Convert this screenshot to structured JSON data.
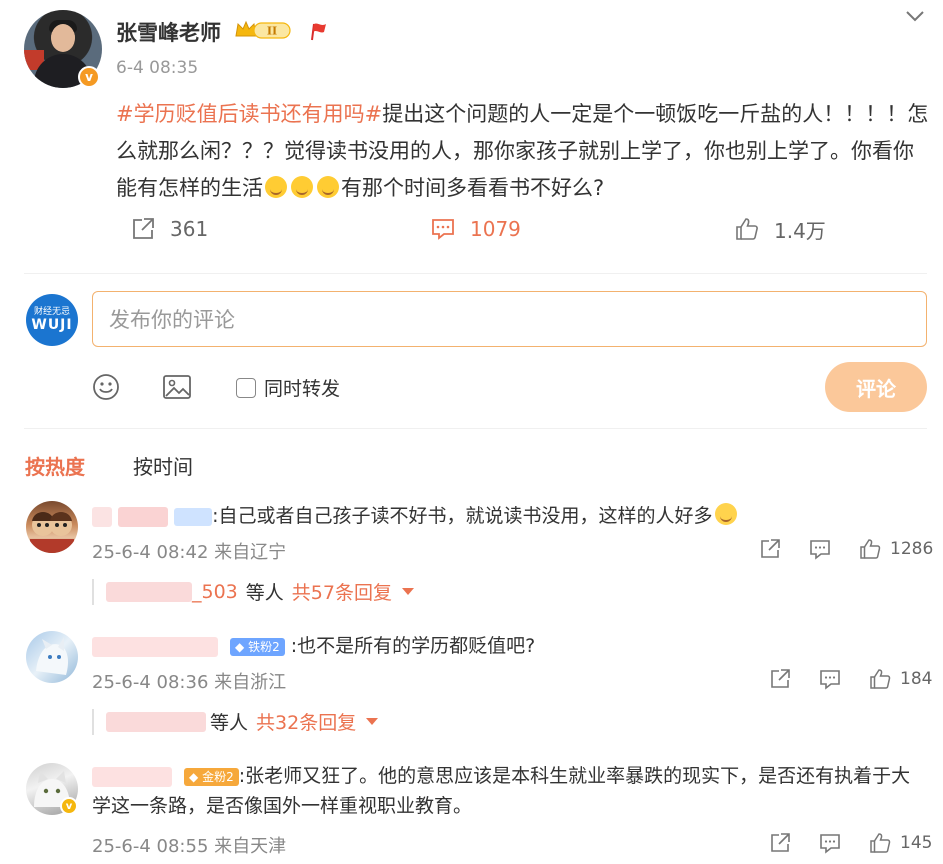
{
  "post": {
    "author": "张雪峰老师",
    "time": "6-4 08:35",
    "hashtag": "#学历贬值后读书还有用吗#",
    "text_part1": "提出这个问题的人一定是个一顿饭吃一斤盐的人！！！！怎么就那么闲？？？觉得读书没用的人，那你家孩子就别上学了，你也别上学了。你看你能有怎样的生活",
    "text_part2": "有那个时间多看看书不好么?",
    "crown_level": "II",
    "shares": "361",
    "comments": "1079",
    "likes": "1.4万"
  },
  "composer": {
    "avatar_line1": "财经无忌",
    "avatar_line2": "WUJI",
    "placeholder": "发布你的评论",
    "forward_label": "同时转发",
    "submit_label": "评论"
  },
  "sort": {
    "hot": "按热度",
    "time": "按时间"
  },
  "comments": [
    {
      "text": ":自己或者自己孩子读不好书，就说读书没用，这样的人好多",
      "time": "25-6-4 08:42",
      "location": "来自辽宁",
      "likes": "1286",
      "reply_user_suffix": "_503",
      "reply_etc": "等人",
      "reply_more": "共57条回复"
    },
    {
      "badge": "铁粉2",
      "text": ":也不是所有的学历都贬值吧?",
      "time": "25-6-4 08:36",
      "location": "来自浙江",
      "likes": "184",
      "reply_etc": "等人",
      "reply_more": "共32条回复"
    },
    {
      "badge": "金粉2",
      "text": ":张老师又狂了。他的意思应该是本科生就业率暴跌的现实下，是否还有执着于大学这一条路，是否像国外一样重视职业教育。",
      "time": "25-6-4 08:55",
      "location": "来自天津",
      "likes": "145"
    }
  ],
  "colors": {
    "accent": "#eb7350",
    "button_disabled": "#fbc89a",
    "input_border": "#f3b26f",
    "vip_badge": "#f59a23"
  }
}
